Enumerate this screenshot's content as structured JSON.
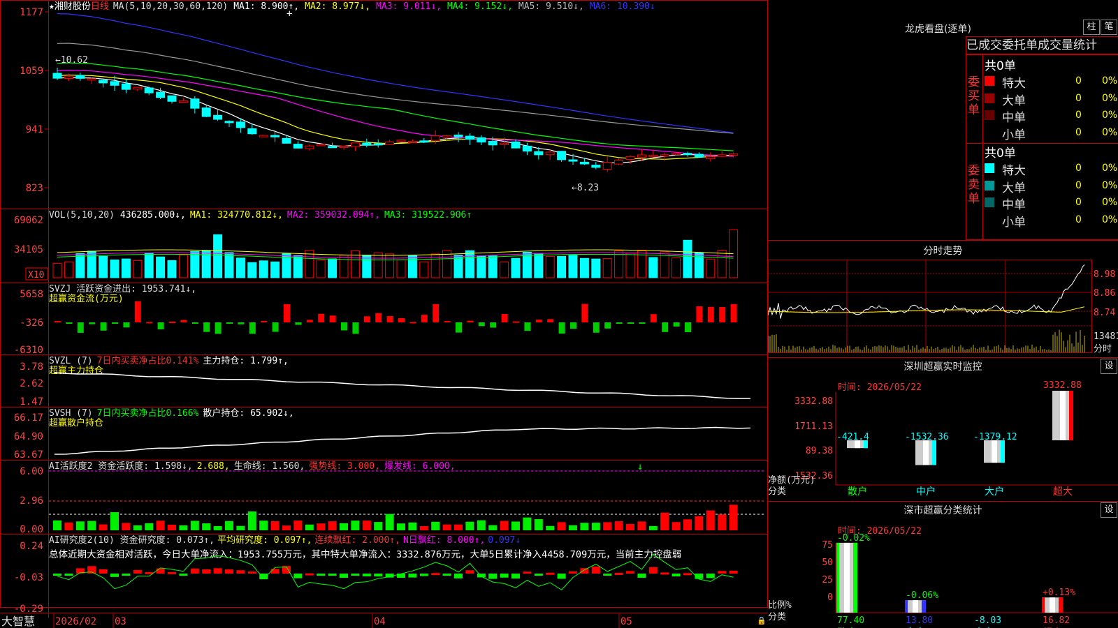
{
  "app": {
    "brand": "大智慧"
  },
  "main_chart": {
    "title": "★湘财股份",
    "period": "日线",
    "ma_params": "MA(5,10,20,30,60,120)",
    "ma1": "MA1: 8.900↑,",
    "ma2": "MA2: 8.977↓,",
    "ma3": "MA3: 9.011↓,",
    "ma4": "MA4: 9.152↓,",
    "ma5": "MA5: 9.510↓,",
    "ma6": "MA6: 10.390↓",
    "y_ticks": [
      "1177",
      "1059",
      "941",
      "823"
    ],
    "high_label": "←10.62",
    "low_label": "←8.23"
  },
  "vol_panel": {
    "header": "VOL(5,10,20)",
    "value": "436285.000↓,",
    "ma1": "MA1: 324770.812↓,",
    "ma2": "MA2: 359032.094↑,",
    "ma3": "MA3: 319522.906↑",
    "y_ticks": [
      "69062",
      "34105"
    ],
    "unit": "X10"
  },
  "svzj_panel": {
    "header": "SVZJ  活跃资金进出: 1953.741↓,",
    "subtitle": "超赢资金流(万元)",
    "y_ticks": [
      "5658",
      "-326",
      "-6310"
    ]
  },
  "svzl_panel": {
    "h1": "SVZL (7)",
    "h2": "7日内买卖净占比0.141%",
    "h3": "主力持仓: 1.799↑,",
    "subtitle": "超赢主力持仓",
    "y_ticks": [
      "3.78",
      "2.62",
      "1.47"
    ]
  },
  "svsh_panel": {
    "h1": "SVSH (7)",
    "h2": "7日内买卖净占比0.166%",
    "h3": "散户持仓: 65.902↓,",
    "subtitle": "超赢散户持仓",
    "y_ticks": [
      "66.17",
      "64.90",
      "63.67"
    ]
  },
  "ai_active_panel": {
    "h1": "AI活跃度2 资金活跃度: 1.598↓,",
    "h2": "2.688,",
    "h3": "生命线: 1.560,",
    "h4": "强势线: 3.000,",
    "h5": "爆发线: 6.000,",
    "y_ticks": [
      "6.00",
      "2.96",
      "0.00"
    ]
  },
  "ai_research_panel": {
    "h1": "AI研究度2(10) 资金研究度: 0.073↑,",
    "h2": "平均研究度: 0.097↑,",
    "h3": "连续飘红: 2.000↑,",
    "h4": "N日飘红: 8.000↑,",
    "h5": "0.097↓",
    "summary": "总体近期大资金相对活跃，今日大单净流入：1953.755万元，其中特大单净流入：3332.876万元，大单5日累计净入4458.709万元，当前主力控盘弱",
    "y_ticks": [
      "0.24",
      "-0.03",
      "-0.29"
    ]
  },
  "date_axis": {
    "labels": [
      "2026/02",
      "03",
      "04",
      "05"
    ]
  },
  "dragon_panel": {
    "title": "龙虎看盘(逐单)",
    "btn_zhu": "柱",
    "btn_bi": "笔",
    "tabs": "已成交委托单成交量统计",
    "buy_label": "委买单",
    "sell_label": "委卖单",
    "buy_total": "共0单",
    "sell_total": "共0单",
    "buy_rows": [
      {
        "name": "特大",
        "count": "0",
        "pct": "0%",
        "color": "#ff0000"
      },
      {
        "name": "大单",
        "count": "0",
        "pct": "0%",
        "color": "#990000"
      },
      {
        "name": "中单",
        "count": "0",
        "pct": "0%",
        "color": "#660000"
      },
      {
        "name": "小单",
        "count": "0",
        "pct": "0%",
        "color": "#000000"
      }
    ],
    "sell_rows": [
      {
        "name": "特大",
        "count": "0",
        "pct": "0%",
        "color": "#00ffff"
      },
      {
        "name": "大单",
        "count": "0",
        "pct": "0%",
        "color": "#009999"
      },
      {
        "name": "中单",
        "count": "0",
        "pct": "0%",
        "color": "#006666"
      },
      {
        "name": "小单",
        "count": "0",
        "pct": "0%",
        "color": "#000000"
      }
    ]
  },
  "intraday_panel": {
    "title": "分时走势",
    "y_ticks": [
      "8.98",
      "8.86",
      "8.74"
    ],
    "vol_label": "13481",
    "vol_unit": "分时"
  },
  "sz_monitor": {
    "title": "深圳超赢实时监控",
    "btn": "设",
    "time": "时间: 2026/05/22",
    "y_ticks": [
      "3332.88",
      "1711.13",
      "89.38",
      "-1532.36"
    ],
    "net_label": "净额(万元)",
    "cat_label": "分类",
    "categories": [
      "散户",
      "中户",
      "大户",
      "超大"
    ],
    "values": [
      -421.4,
      -1532.36,
      -1379.12,
      3332.88
    ],
    "value_labels": [
      "-421.4",
      "-1532.36",
      "-1379.12",
      "3332.88"
    ]
  },
  "sz_class": {
    "title": "深市超赢分类统计",
    "btn": "设",
    "time": "时间: 2026/05/22",
    "y_ticks": [
      "75",
      "50",
      "25",
      "0"
    ],
    "ratio_label": "比例%",
    "cat_label": "分类",
    "categories": [
      "散户",
      "中户",
      "大户",
      "超大"
    ],
    "bar_pcts": [
      77.4,
      13.8,
      0,
      16.82
    ],
    "top_labels": [
      "-0.02%",
      "-0.06%",
      "",
      "+0.13%"
    ],
    "bottom_labels": [
      "77.40",
      "13.80",
      "-8.03",
      "16.82"
    ]
  },
  "colors": {
    "up": "#ff0000",
    "down": "#00ffff",
    "ma1": "#ffffff",
    "ma2": "#ffff00",
    "ma3": "#ff00ff",
    "ma4": "#00ff00",
    "ma5": "#999999",
    "ma6": "#3333ff",
    "grid": "#aa0000"
  }
}
